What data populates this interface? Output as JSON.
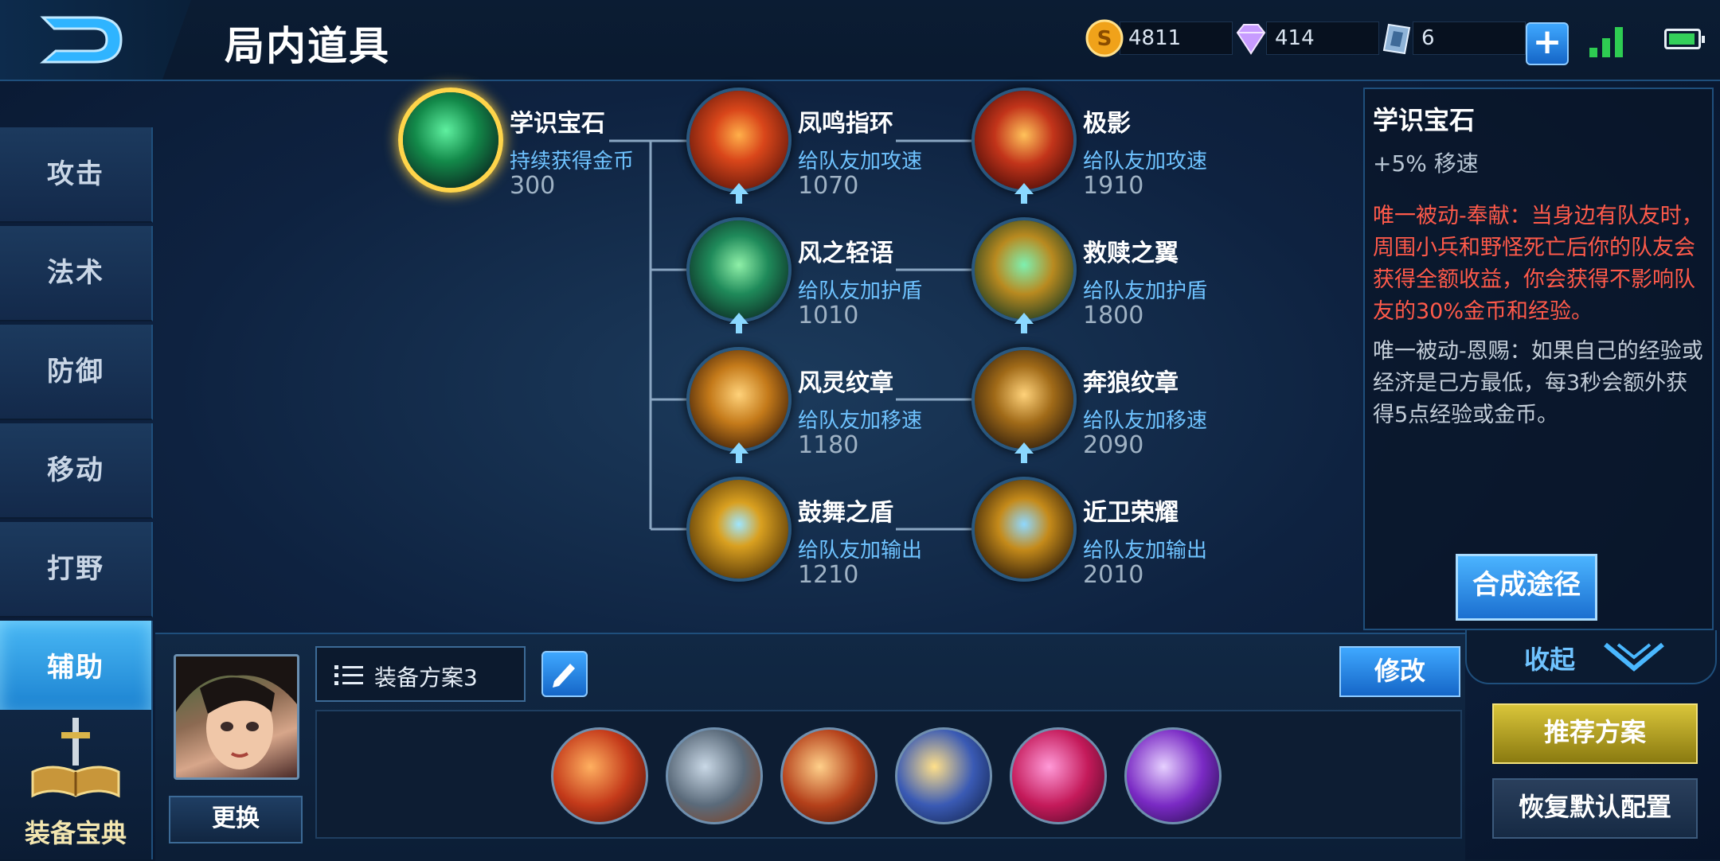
{
  "header": {
    "title": "局内道具",
    "gold": "4811",
    "diamonds": "414",
    "vouchers": "6",
    "plus_label": "+"
  },
  "nav": {
    "items": [
      {
        "label": "攻击"
      },
      {
        "label": "法术"
      },
      {
        "label": "防御"
      },
      {
        "label": "移动"
      },
      {
        "label": "打野"
      },
      {
        "label": "辅助"
      }
    ],
    "active": "辅助",
    "codex_label": "装备宝典"
  },
  "tree": {
    "root": {
      "name": "学识宝石",
      "desc": "持续获得金币",
      "price": "300"
    },
    "tier2": [
      {
        "name": "凤鸣指环",
        "desc": "给队友加攻速",
        "price": "1070"
      },
      {
        "name": "风之轻语",
        "desc": "给队友加护盾",
        "price": "1010"
      },
      {
        "name": "风灵纹章",
        "desc": "给队友加移速",
        "price": "1180"
      },
      {
        "name": "鼓舞之盾",
        "desc": "给队友加输出",
        "price": "1210"
      }
    ],
    "tier3": [
      {
        "name": "极影",
        "desc": "给队友加攻速",
        "price": "1910"
      },
      {
        "name": "救赎之翼",
        "desc": "给队友加护盾",
        "price": "1800"
      },
      {
        "name": "奔狼纹章",
        "desc": "给队友加移速",
        "price": "2090"
      },
      {
        "name": "近卫荣耀",
        "desc": "给队友加输出",
        "price": "2010"
      }
    ]
  },
  "detail": {
    "title": "学识宝石",
    "stat": "+5% 移速",
    "passive1": "唯一被动-奉献：当身边有队友时，周围小兵和野怪死亡后你的队友会获得全额收益，你会获得不影响队友的30%金币和经验。",
    "passive2": "唯一被动-恩赐：如果自己的经验或经济是己方最低，每3秒会额外获得5点经验或金币。",
    "synth_button": "合成途径",
    "collapse": "收起"
  },
  "bottom": {
    "change_button": "更换",
    "plan_label": "装备方案3",
    "modify_button": "修改",
    "recommend_button": "推荐方案",
    "reset_button": "恢复默认配置"
  },
  "colors": {
    "accent_blue": "#3fa8ff",
    "gold_border": "#ffd54a",
    "passive_red": "#ff5a4a",
    "desc_blue": "#6fc3ff"
  },
  "icons": [
    "back-icon",
    "gold-coin-icon",
    "diamond-icon",
    "voucher-icon",
    "plus-icon",
    "signal-icon",
    "battery-icon",
    "list-icon",
    "pencil-icon",
    "chevron-down-icon",
    "book-sword-icon",
    "upgrade-arrow-icon"
  ]
}
